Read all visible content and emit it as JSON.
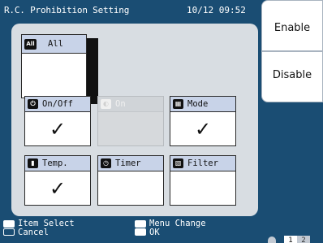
{
  "header": {
    "title": "R.C. Prohibition Setting",
    "clock": "10/12 09:52"
  },
  "tiles": [
    {
      "id": "all",
      "icon": "all-icon",
      "icon_text": "All",
      "label": "All",
      "checked": false,
      "enabled": true
    },
    {
      "id": "onoff",
      "icon": "power-icon",
      "label": "On/Off",
      "checked": true,
      "enabled": true
    },
    {
      "id": "on",
      "icon": "on-icon",
      "label": "On",
      "checked": false,
      "enabled": false
    },
    {
      "id": "mode",
      "icon": "mode-icon",
      "label": "Mode",
      "checked": true,
      "enabled": true
    },
    {
      "id": "temp",
      "icon": "thermometer-icon",
      "label": "Temp.",
      "checked": true,
      "enabled": true
    },
    {
      "id": "timer",
      "icon": "clock-icon",
      "label": "Timer",
      "checked": false,
      "enabled": true
    },
    {
      "id": "filter",
      "icon": "filter-icon",
      "label": "Filter",
      "checked": false,
      "enabled": true
    }
  ],
  "check_glyph": "✓",
  "side_buttons": {
    "enable": "Enable",
    "disable": "Disable"
  },
  "footer": {
    "item_select": "Item Select",
    "cancel": "Cancel",
    "menu_change": "Menu Change",
    "ok": "OK",
    "page_current": "1",
    "page_next": "2"
  },
  "colors": {
    "background": "#1a4d73",
    "panel": "#d8dde2",
    "tile_header": "#c8d3e8"
  }
}
